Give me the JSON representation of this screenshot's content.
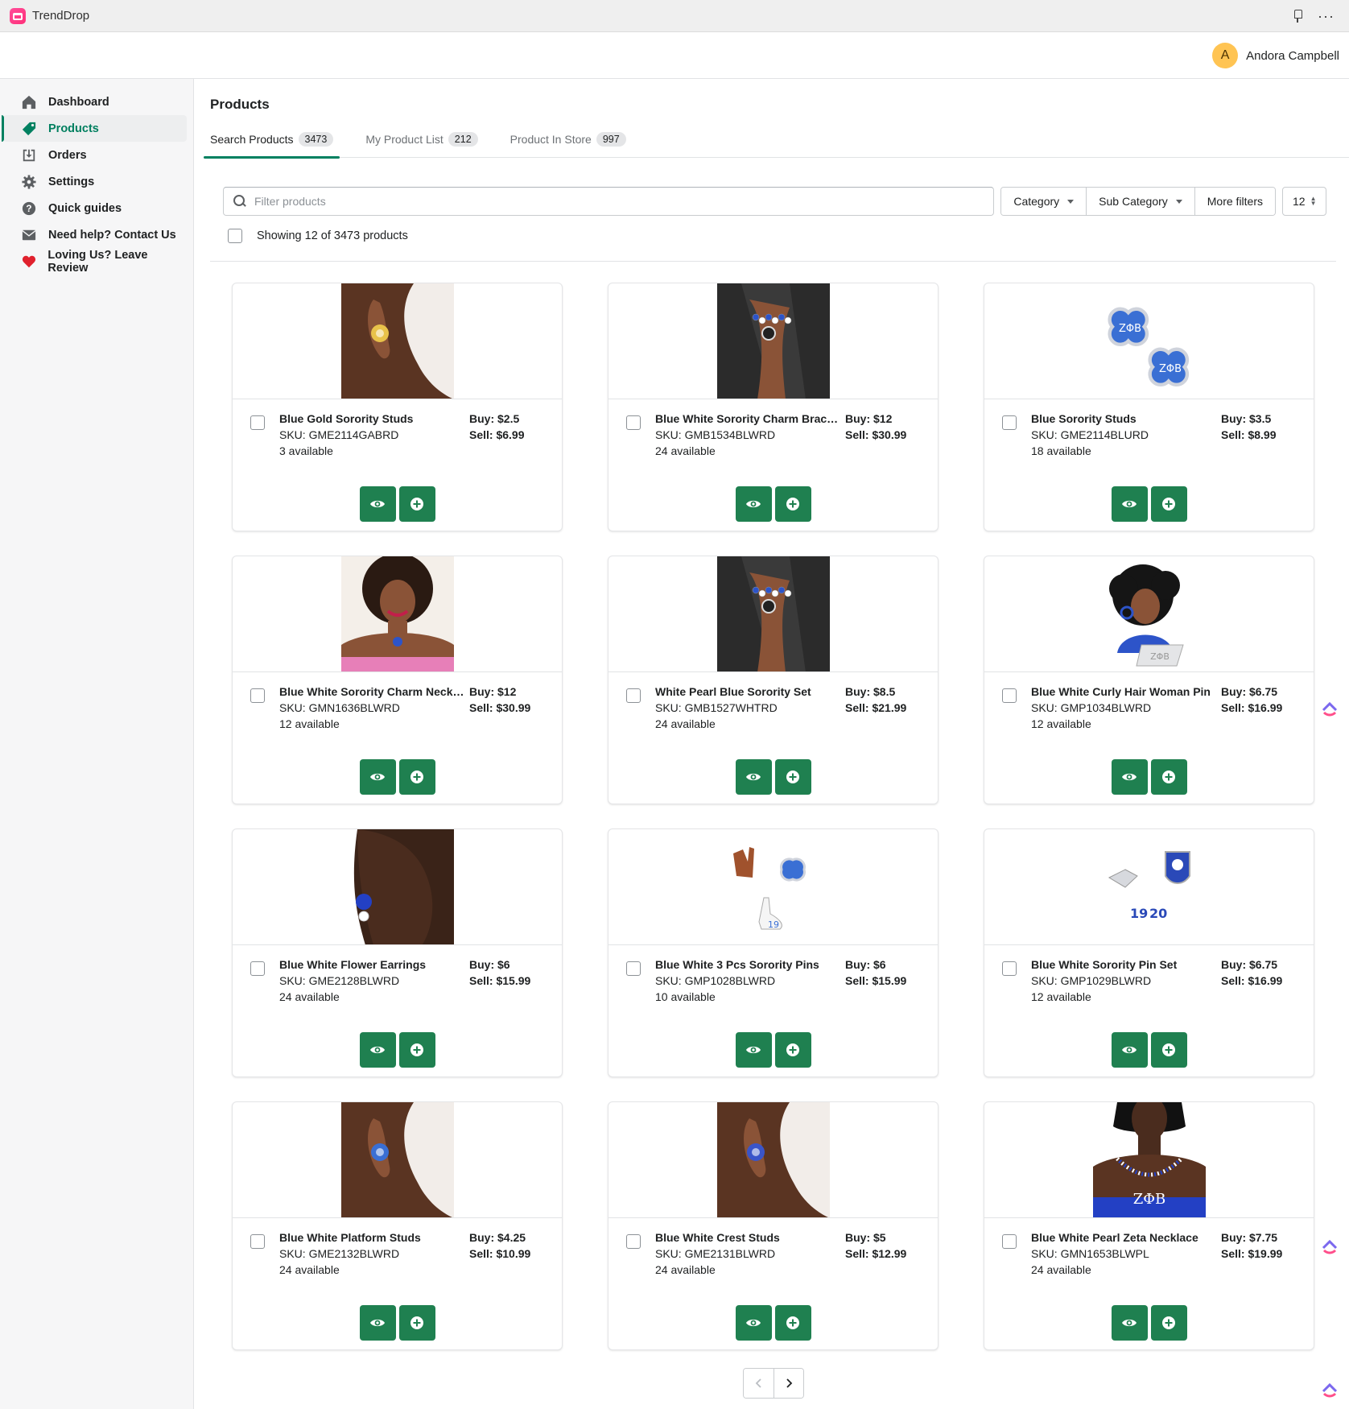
{
  "app": {
    "name": "TrendDrop"
  },
  "user": {
    "initial": "A",
    "name": "Andora Campbell"
  },
  "sidebar": {
    "items": [
      {
        "label": "Dashboard",
        "icon": "home-icon"
      },
      {
        "label": "Products",
        "icon": "tag-icon",
        "active": true
      },
      {
        "label": "Orders",
        "icon": "inbox-download-icon"
      },
      {
        "label": "Settings",
        "icon": "gear-icon"
      },
      {
        "label": "Quick guides",
        "icon": "question-circle-icon"
      },
      {
        "label": "Need help? Contact Us",
        "icon": "envelope-icon"
      },
      {
        "label": "Loving Us? Leave Review",
        "icon": "heart-icon"
      }
    ]
  },
  "page": {
    "title": "Products"
  },
  "tabs": [
    {
      "label": "Search Products",
      "count": "3473",
      "active": true
    },
    {
      "label": "My Product List",
      "count": "212"
    },
    {
      "label": "Product In Store",
      "count": "997"
    }
  ],
  "filters": {
    "search_placeholder": "Filter products",
    "category": "Category",
    "sub_category": "Sub Category",
    "more": "More filters",
    "page_size": "12"
  },
  "showing": "Showing 12 of 3473 products",
  "products": [
    {
      "name": "Blue Gold Sorority Studs",
      "sku": "SKU: GME2114GABRD",
      "available": "3 available",
      "buy": "Buy: $2.5",
      "sell": "Sell: $6.99"
    },
    {
      "name": "Blue White Sorority Charm Bracelet",
      "sku": "SKU: GMB1534BLWRD",
      "available": "24 available",
      "buy": "Buy: $12",
      "sell": "Sell: $30.99"
    },
    {
      "name": "Blue Sorority Studs",
      "sku": "SKU: GME2114BLURD",
      "available": "18 available",
      "buy": "Buy: $3.5",
      "sell": "Sell: $8.99"
    },
    {
      "name": "Blue White Sorority Charm Necklace",
      "sku": "SKU: GMN1636BLWRD",
      "available": "12 available",
      "buy": "Buy: $12",
      "sell": "Sell: $30.99"
    },
    {
      "name": "White Pearl Blue Sorority Set",
      "sku": "SKU: GMB1527WHTRD",
      "available": "24 available",
      "buy": "Buy: $8.5",
      "sell": "Sell: $21.99"
    },
    {
      "name": "Blue White Curly Hair Woman Pin",
      "sku": "SKU: GMP1034BLWRD",
      "available": "12 available",
      "buy": "Buy: $6.75",
      "sell": "Sell: $16.99"
    },
    {
      "name": "Blue White Flower Earrings",
      "sku": "SKU: GME2128BLWRD",
      "available": "24 available",
      "buy": "Buy: $6",
      "sell": "Sell: $15.99"
    },
    {
      "name": "Blue White 3 Pcs Sorority Pins",
      "sku": "SKU: GMP1028BLWRD",
      "available": "10 available",
      "buy": "Buy: $6",
      "sell": "Sell: $15.99"
    },
    {
      "name": "Blue White Sorority Pin Set",
      "sku": "SKU: GMP1029BLWRD",
      "available": "12 available",
      "buy": "Buy: $6.75",
      "sell": "Sell: $16.99"
    },
    {
      "name": "Blue White Platform Studs",
      "sku": "SKU: GME2132BLWRD",
      "available": "24 available",
      "buy": "Buy: $4.25",
      "sell": "Sell: $10.99"
    },
    {
      "name": "Blue White Crest Studs",
      "sku": "SKU: GME2131BLWRD",
      "available": "24 available",
      "buy": "Buy: $5",
      "sell": "Sell: $12.99"
    },
    {
      "name": "Blue White Pearl Zeta Necklace",
      "sku": "SKU: GMN1653BLWPL",
      "available": "24 available",
      "buy": "Buy: $7.75",
      "sell": "Sell: $19.99"
    }
  ],
  "product_images": [
    {
      "kind": "ear",
      "accent": "#e8c24a"
    },
    {
      "kind": "wrist",
      "accent": "#2d54c9"
    },
    {
      "kind": "studs",
      "accent": "#3a6fd4"
    },
    {
      "kind": "portrait-afro",
      "accent": "#2d54c9"
    },
    {
      "kind": "wrist",
      "accent": "#2d54c9"
    },
    {
      "kind": "pin-woman",
      "accent": "#2d54c9"
    },
    {
      "kind": "side-face",
      "accent": "#2340c4"
    },
    {
      "kind": "pins-3",
      "accent": "#3a6fd4"
    },
    {
      "kind": "pin-set",
      "accent": "#2a49b8"
    },
    {
      "kind": "ear",
      "accent": "#3a6fd4"
    },
    {
      "kind": "ear",
      "accent": "#3a55c9"
    },
    {
      "kind": "necklace",
      "accent": "#2340c4"
    }
  ],
  "image_text": {
    "greek": "ZΦB",
    "year_a": "19",
    "year_b": "20"
  },
  "colors": {
    "accent": "#008060",
    "action": "#1f8050"
  }
}
